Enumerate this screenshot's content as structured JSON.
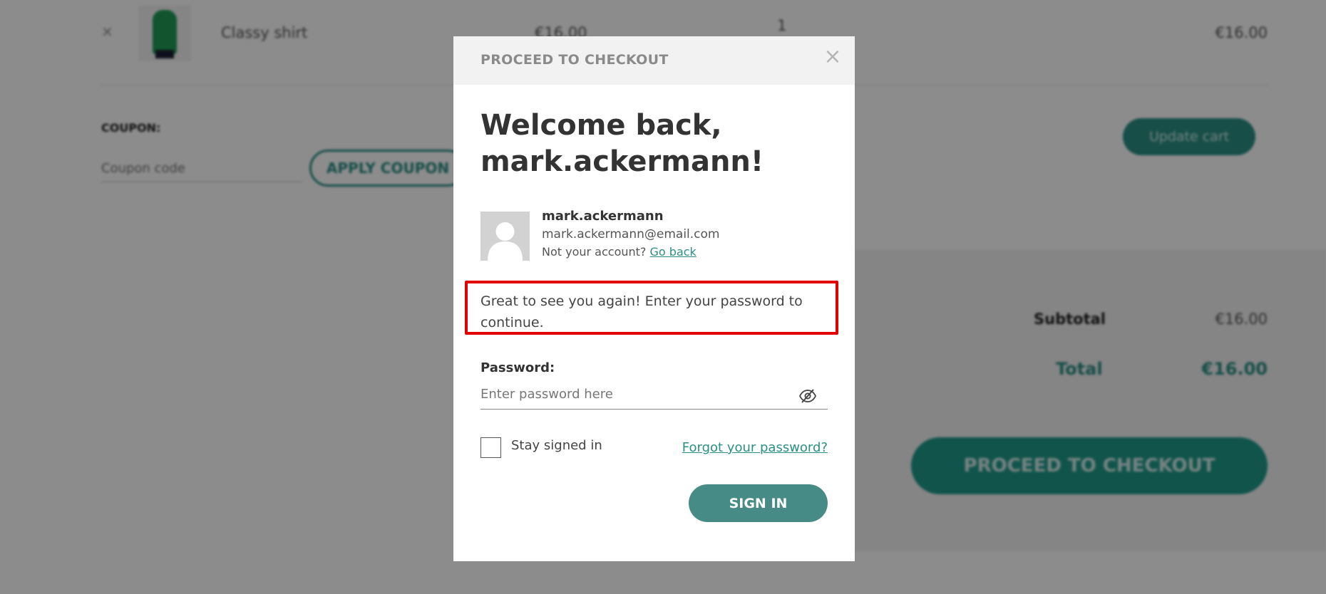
{
  "background": {
    "cart_item": {
      "remove_symbol": "×",
      "name": "Classy shirt",
      "price": "€16.00",
      "quantity": "1",
      "subtotal": "€16.00"
    },
    "coupon": {
      "label": "COUPON:",
      "placeholder": "Coupon code",
      "apply_label": "APPLY COUPON"
    },
    "update_cart_label": "Update cart",
    "totals": {
      "subtotal_label": "Subtotal",
      "subtotal_value": "€16.00",
      "total_label": "Total",
      "total_value": "€16.00"
    },
    "proceed_label": "PROCEED TO CHECKOUT"
  },
  "modal": {
    "title": "PROCEED TO CHECKOUT",
    "close_symbol": "×",
    "welcome_line1": "Welcome back,",
    "welcome_line2": "mark.ackermann!",
    "user": {
      "username": "mark.ackermann",
      "email": "mark.ackermann@email.com",
      "not_your_account": "Not your account?",
      "go_back": "Go back"
    },
    "message": "Great to see you again! Enter your password to continue.",
    "password": {
      "label": "Password:",
      "placeholder": "Enter password here",
      "value": ""
    },
    "stay_signed_in": "Stay signed in",
    "forgot_password": "Forgot your password?",
    "sign_in_label": "SIGN IN"
  },
  "colors": {
    "accent": "#468b85",
    "link": "#2a8f84",
    "highlight_border": "#e30000"
  },
  "icons": {
    "close": "close-icon",
    "eye": "eye-slash-icon",
    "avatar": "user-avatar-placeholder"
  }
}
